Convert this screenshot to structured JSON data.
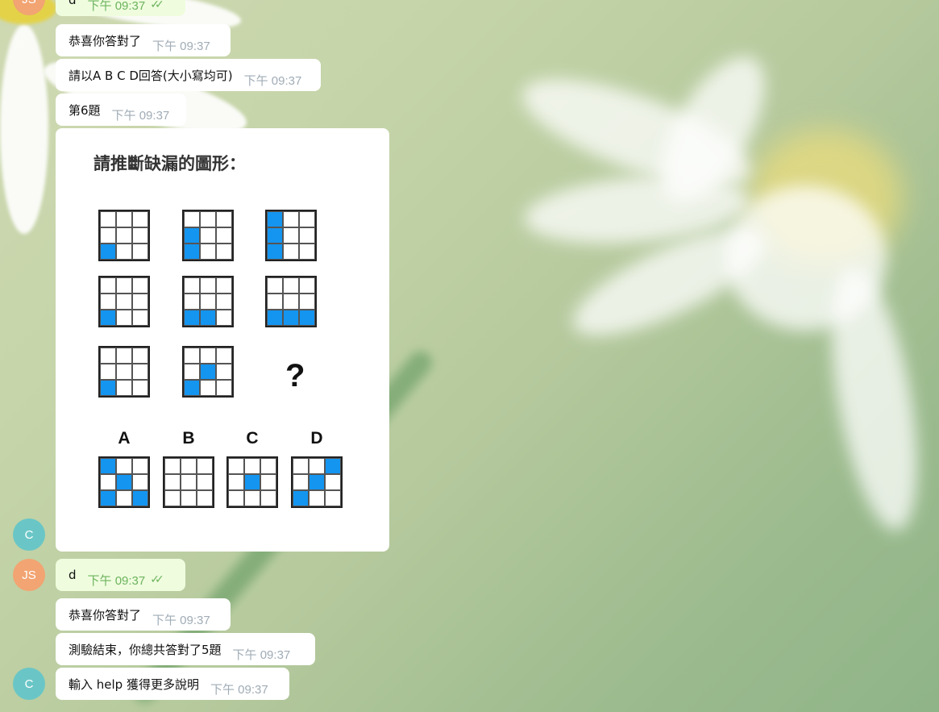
{
  "messages": [
    {
      "avatar": "JS",
      "text": "d",
      "time": "下午 09:37",
      "outgoing": true
    },
    {
      "text": "恭喜你答對了",
      "time": "下午 09:37"
    },
    {
      "text": "請以A B C D回答(大小寫均可)",
      "time": "下午 09:37"
    },
    {
      "text": "第6題",
      "time": "下午 09:37"
    },
    {
      "avatar": "C"
    },
    {
      "avatar": "JS",
      "text": "d",
      "time": "下午 09:37",
      "outgoing": true
    },
    {
      "text": "恭喜你答對了",
      "time": "下午 09:37"
    },
    {
      "text": "測驗結束，你總共答對了5題",
      "time": "下午 09:37"
    },
    {
      "avatar": "C",
      "text": "輸入 help 獲得更多說明",
      "time": "下午 09:37"
    }
  ],
  "puzzle": {
    "title": "請推斷缺漏的圖形：",
    "question_mark": "?",
    "grid": [
      [
        [
          0,
          0,
          0,
          0,
          0,
          0,
          1,
          0,
          0
        ],
        [
          0,
          0,
          0,
          1,
          0,
          0,
          1,
          0,
          0
        ],
        [
          1,
          0,
          0,
          1,
          0,
          0,
          1,
          0,
          0
        ]
      ],
      [
        [
          0,
          0,
          0,
          0,
          0,
          0,
          1,
          0,
          0
        ],
        [
          0,
          0,
          0,
          0,
          0,
          0,
          1,
          1,
          0
        ],
        [
          0,
          0,
          0,
          0,
          0,
          0,
          1,
          1,
          1
        ]
      ],
      [
        [
          0,
          0,
          0,
          0,
          0,
          0,
          1,
          0,
          0
        ],
        [
          0,
          0,
          0,
          0,
          1,
          0,
          1,
          0,
          0
        ]
      ]
    ],
    "options": [
      {
        "label": "A",
        "cells": [
          1,
          0,
          0,
          0,
          1,
          0,
          1,
          0,
          1
        ]
      },
      {
        "label": "B",
        "cells": [
          0,
          0,
          0,
          0,
          0,
          0,
          0,
          0,
          0
        ]
      },
      {
        "label": "C",
        "cells": [
          0,
          0,
          0,
          0,
          1,
          0,
          0,
          0,
          0
        ]
      },
      {
        "label": "D",
        "cells": [
          0,
          0,
          1,
          0,
          1,
          0,
          1,
          0,
          0
        ]
      }
    ]
  },
  "colors": {
    "cell_filled": "#1495f0",
    "outgoing_bubble": "#effdde",
    "incoming_bubble": "#ffffff",
    "avatar_js": "#f2a472",
    "avatar_c": "#6ac6c6"
  },
  "icons": {
    "read_ticks": "double-check-icon"
  }
}
